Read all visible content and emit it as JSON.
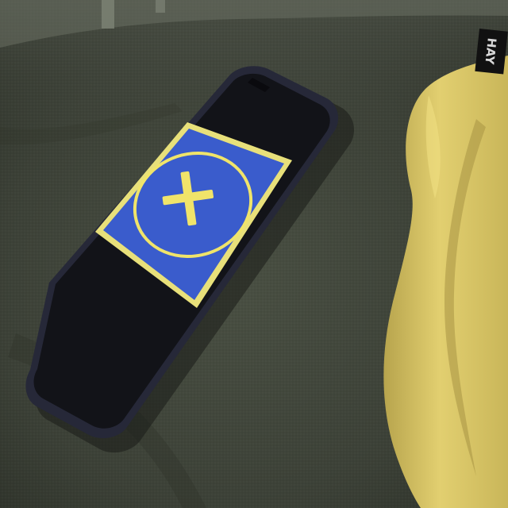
{
  "scene": {
    "description_label": "",
    "phone_screen": {
      "icon": "plus-in-circle-icon",
      "background_color": "#3a5ccc",
      "border_color": "#e8e07a",
      "symbol_color": "#f0e46a"
    },
    "tag_text": "HAY",
    "colors": {
      "fabric": "#3f4439",
      "fabric_dark": "#2e3229",
      "phone_body": "#15161d",
      "phone_edge": "#262838",
      "cushion": "#d8c567",
      "cushion_shadow": "#a89443",
      "tag": "#111111"
    }
  }
}
